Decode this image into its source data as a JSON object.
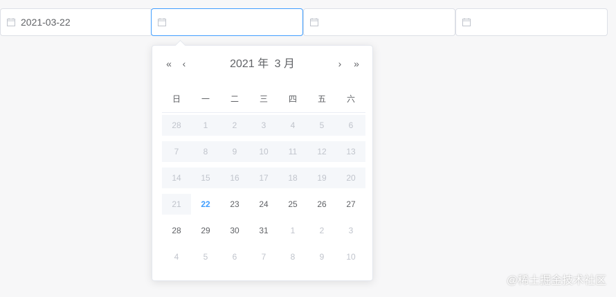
{
  "inputs": [
    {
      "value": "2021-03-22",
      "focused": false
    },
    {
      "value": "",
      "focused": true
    },
    {
      "value": "",
      "focused": false
    },
    {
      "value": "",
      "focused": false
    }
  ],
  "icons": {
    "calendar": "calendar-icon",
    "prev_year": "double-chevron-left-icon",
    "prev_month": "chevron-left-icon",
    "next_month": "chevron-right-icon",
    "next_year": "double-chevron-right-icon"
  },
  "picker": {
    "nav": {
      "prev_year": "«",
      "prev_month": "‹",
      "next_month": "›",
      "next_year": "»"
    },
    "header": {
      "year": "2021 年",
      "month": "3 月"
    },
    "weekdays": [
      "日",
      "一",
      "二",
      "三",
      "四",
      "五",
      "六"
    ],
    "weeks": [
      [
        {
          "d": "28",
          "s": "disabled"
        },
        {
          "d": "1",
          "s": "disabled"
        },
        {
          "d": "2",
          "s": "disabled"
        },
        {
          "d": "3",
          "s": "disabled"
        },
        {
          "d": "4",
          "s": "disabled"
        },
        {
          "d": "5",
          "s": "disabled"
        },
        {
          "d": "6",
          "s": "disabled"
        }
      ],
      [
        {
          "d": "7",
          "s": "disabled"
        },
        {
          "d": "8",
          "s": "disabled"
        },
        {
          "d": "9",
          "s": "disabled"
        },
        {
          "d": "10",
          "s": "disabled"
        },
        {
          "d": "11",
          "s": "disabled"
        },
        {
          "d": "12",
          "s": "disabled"
        },
        {
          "d": "13",
          "s": "disabled"
        }
      ],
      [
        {
          "d": "14",
          "s": "disabled"
        },
        {
          "d": "15",
          "s": "disabled"
        },
        {
          "d": "16",
          "s": "disabled"
        },
        {
          "d": "17",
          "s": "disabled"
        },
        {
          "d": "18",
          "s": "disabled"
        },
        {
          "d": "19",
          "s": "disabled"
        },
        {
          "d": "20",
          "s": "disabled"
        }
      ],
      [
        {
          "d": "21",
          "s": "disabled"
        },
        {
          "d": "22",
          "s": "today"
        },
        {
          "d": "23",
          "s": "normal"
        },
        {
          "d": "24",
          "s": "normal"
        },
        {
          "d": "25",
          "s": "normal"
        },
        {
          "d": "26",
          "s": "normal"
        },
        {
          "d": "27",
          "s": "normal"
        }
      ],
      [
        {
          "d": "28",
          "s": "normal"
        },
        {
          "d": "29",
          "s": "normal"
        },
        {
          "d": "30",
          "s": "normal"
        },
        {
          "d": "31",
          "s": "normal"
        },
        {
          "d": "1",
          "s": "other"
        },
        {
          "d": "2",
          "s": "other"
        },
        {
          "d": "3",
          "s": "other"
        }
      ],
      [
        {
          "d": "4",
          "s": "other"
        },
        {
          "d": "5",
          "s": "other"
        },
        {
          "d": "6",
          "s": "other"
        },
        {
          "d": "7",
          "s": "other"
        },
        {
          "d": "8",
          "s": "other"
        },
        {
          "d": "9",
          "s": "other"
        },
        {
          "d": "10",
          "s": "other"
        }
      ]
    ]
  },
  "watermark": "@稀土掘金技术社区",
  "colors": {
    "accent": "#409eff",
    "disabled_bg": "#f5f7fa",
    "muted_text": "#c0c4cc"
  }
}
